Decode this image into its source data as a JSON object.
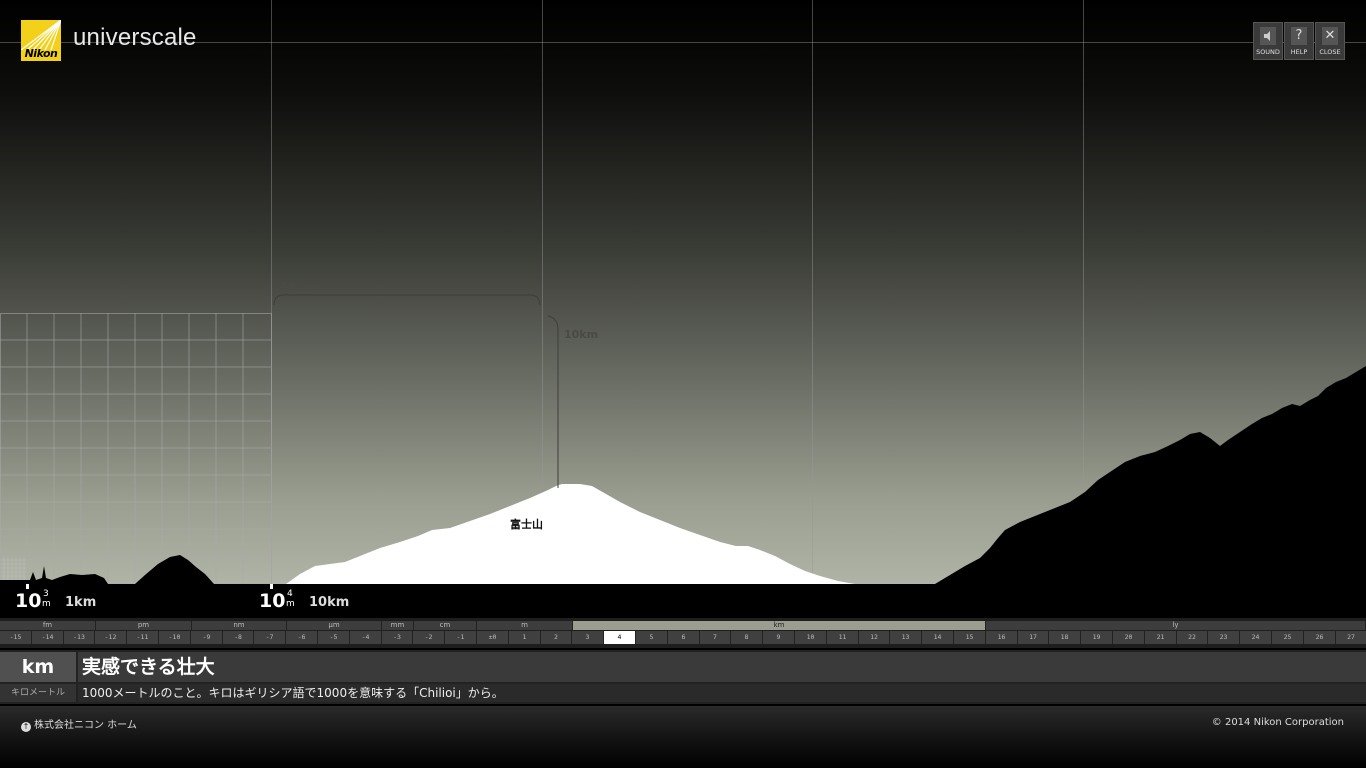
{
  "app": {
    "title": "universcale",
    "logo_text": "Nikon"
  },
  "toolbar": {
    "buttons": [
      {
        "label": "SOUND",
        "icon": "speaker-icon"
      },
      {
        "label": "HELP",
        "icon": "help-icon",
        "glyph": "?"
      },
      {
        "label": "CLOSE",
        "icon": "close-icon",
        "glyph": "✕"
      }
    ]
  },
  "scene": {
    "measure_top": "10km",
    "measure_side": "10km",
    "fuji_label": "富士山"
  },
  "scale": {
    "left": {
      "base": "10",
      "exp": "3",
      "unit": "m",
      "text": "1km"
    },
    "right": {
      "base": "10",
      "exp": "4",
      "unit": "m",
      "text": "10km"
    }
  },
  "ruler": {
    "groups": [
      "fm",
      "pm",
      "nm",
      "μm",
      "mm",
      "cm",
      "m",
      "km",
      "ly"
    ],
    "active_group": "km",
    "values": [
      "-15",
      "-14",
      "-13",
      "-12",
      "-11",
      "-10",
      "-9",
      "-8",
      "-7",
      "-6",
      "-5",
      "-4",
      "-3",
      "-2",
      "-1",
      "±0",
      "1",
      "2",
      "3",
      "4",
      "5",
      "6",
      "7",
      "8",
      "9",
      "10",
      "11",
      "12",
      "13",
      "14",
      "15",
      "16",
      "17",
      "18",
      "19",
      "20",
      "21",
      "22",
      "23",
      "24",
      "25",
      "26",
      "27"
    ],
    "active_value": "4"
  },
  "info": {
    "unit": "km",
    "reading": "キロメートル",
    "headline": "実感できる壮大",
    "description": "1000メートルのこと。キロはギリシア語で1000を意味する「Chilioi」から。"
  },
  "footer": {
    "home_link": "株式会社ニコン ホーム",
    "copyright": "© 2014 Nikon Corporation"
  }
}
